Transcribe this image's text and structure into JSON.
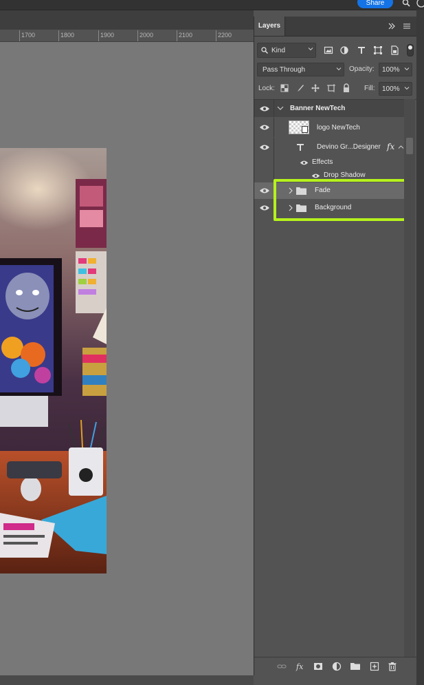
{
  "topbar": {
    "share_label": "Share"
  },
  "ruler": {
    "labels": [
      "1700",
      "1800",
      "1900",
      "2000",
      "2100",
      "2200"
    ]
  },
  "layers_panel": {
    "tab_label": "Layers",
    "filter": {
      "kind_label": "Kind"
    },
    "blend_mode": "Pass Through",
    "opacity_label": "Opacity:",
    "opacity_value": "100%",
    "lock_label": "Lock:",
    "fill_label": "Fill:",
    "fill_value": "100%",
    "layers": [
      {
        "name": "Banner NewTech",
        "type": "group",
        "expanded": true
      },
      {
        "name": "logo NewTech",
        "type": "smart-object"
      },
      {
        "name": "Devino Gr...Designer",
        "type": "text",
        "fx": "fx"
      },
      {
        "name": "Effects",
        "type": "effects"
      },
      {
        "name": "Drop Shadow",
        "type": "effect"
      },
      {
        "name": "Fade",
        "type": "group",
        "expanded": false
      },
      {
        "name": "Background",
        "type": "group",
        "expanded": false
      }
    ],
    "highlight_color": "#b5f21c"
  },
  "colors": {
    "accent": "#1473e6",
    "panel_bg": "#535353",
    "canvas_bg": "#787878"
  }
}
